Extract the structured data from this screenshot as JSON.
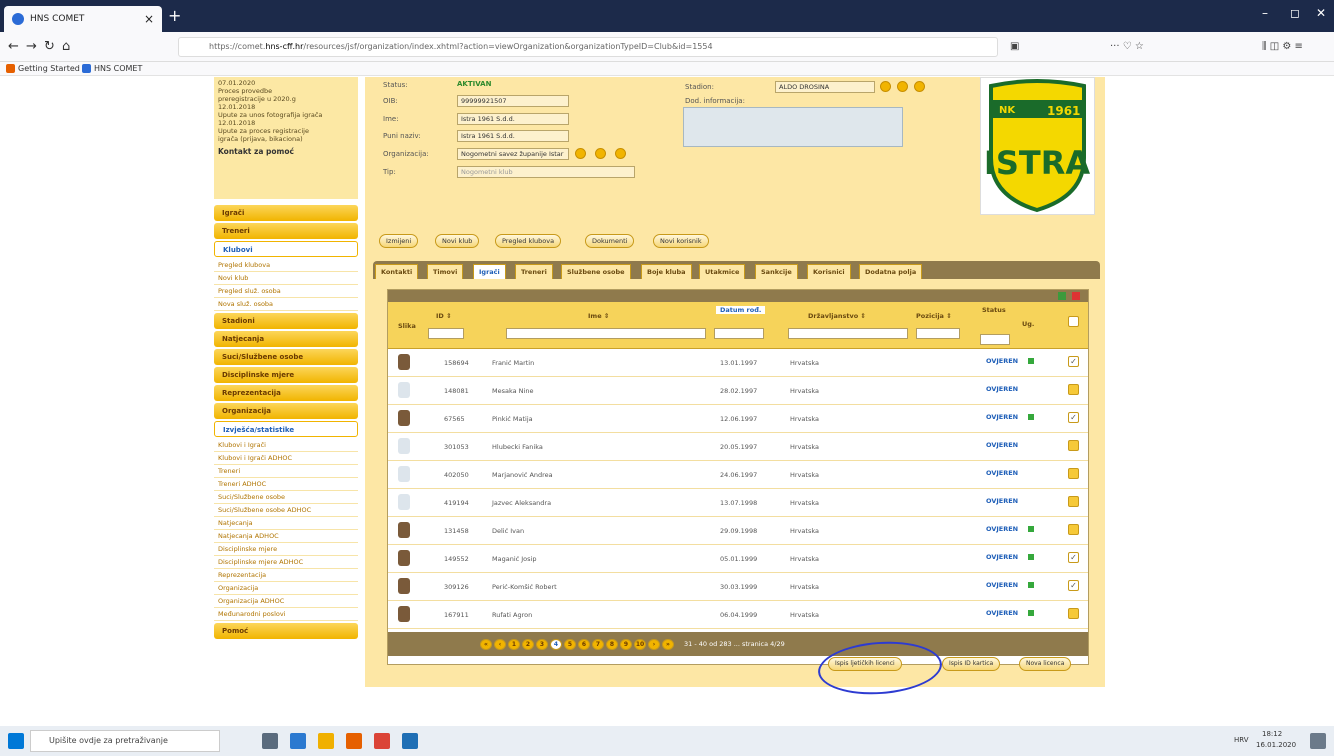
{
  "browser": {
    "tab_title": "HNS COMET",
    "url_pre": "https://comet.",
    "url_host": "hns-cff.hr",
    "url_post": "/resources/jsf/organization/index.xhtml?action=viewOrganization&organizationTypeID=Club&id=1554",
    "bookmarks": [
      "Getting Started",
      "HNS COMET"
    ]
  },
  "news": {
    "lines": [
      "07.01.2020",
      "Proces provedbe",
      "preregistracije u 2020.g",
      "12.01.2018",
      "Upute za unos fotografija igrača",
      "12.01.2018",
      "Upute za proces registracije",
      "igrača (prijava, bikaciona)"
    ],
    "contact": "Kontakt za pomoć"
  },
  "menu": {
    "top": [
      "Igrači",
      "Treneri"
    ],
    "open": "Klubovi",
    "klubovi_sub": [
      "Pregled klubova",
      "Novi klub",
      "Pregled služ. osoba",
      "Nova služ. osoba"
    ],
    "mid": [
      "Stadioni",
      "Natjecanja",
      "Suci/Službene osobe",
      "Disciplinske mjere",
      "Reprezentacija",
      "Organizacija"
    ],
    "open2": "Izvješća/statistike",
    "izvjesca_sub": [
      "Klubovi i Igrači",
      "Klubovi i Igrači ADHOC",
      "Treneri",
      "Treneri ADHOC",
      "Suci/Službene osobe",
      "Suci/Službene osobe ADHOC",
      "Natjecanja",
      "Natjecanja ADHOC",
      "Disciplinske mjere",
      "Disciplinske mjere ADHOC",
      "Reprezentacija",
      "Organizacija",
      "Organizacija ADHOC",
      "Međunarodni poslovi"
    ],
    "last": "Pomoć"
  },
  "form": {
    "status_label": "Status:",
    "status_value": "AKTIVAN",
    "oib_label": "OIB:",
    "oib_value": "99999921507",
    "ime_label": "Ime:",
    "ime_value": "Istra 1961 S.d.d.",
    "puni_label": "Puni naziv:",
    "puni_value": "Istra 1961 S.d.d.",
    "org_label": "Organizacija:",
    "org_value": "Nogometni savez županije Istar",
    "tip_label": "Tip:",
    "tip_value": "Nogometni klub",
    "stadion_label": "Stadion:",
    "stadion_value": "ALDO DROSINA",
    "dod_label": "Dod. informacija:"
  },
  "logo": {
    "line1": "NK",
    "line2": "1961",
    "name": "ISTRA"
  },
  "actions": [
    "Izmijeni",
    "Novi klub",
    "Pregled klubova",
    "Dokumenti",
    "Novi korisnik"
  ],
  "tabs": [
    "Kontakti",
    "Timovi",
    "Igrači",
    "Treneri",
    "Službene osobe",
    "Boje kluba",
    "Utakmice",
    "Sankcije",
    "Korisnici",
    "Dodatna polja"
  ],
  "grid_headers": {
    "slika": "Slika",
    "id": "ID ⇕",
    "ime": "Ime ⇕",
    "datum": "Datum rođ.",
    "drz": "Državljanstvo ⇕",
    "poz": "Pozicija ⇕",
    "status": "Status",
    "ug": "Ug."
  },
  "rows": [
    {
      "id": "158694",
      "name": "Franić Martin",
      "date": "13.01.1997",
      "country": "Hrvatska",
      "status": "OVJEREN",
      "green": true,
      "checked": true,
      "photo": true
    },
    {
      "id": "148081",
      "name": "Mesaka Nine",
      "date": "28.02.1997",
      "country": "Hrvatska",
      "status": "OVJEREN",
      "green": false,
      "checked": false,
      "photo": false
    },
    {
      "id": "67565",
      "name": "Pinkić Matija",
      "date": "12.06.1997",
      "country": "Hrvatska",
      "status": "OVJEREN",
      "green": true,
      "checked": true,
      "photo": true
    },
    {
      "id": "301053",
      "name": "Hlubecki Fanika",
      "date": "20.05.1997",
      "country": "Hrvatska",
      "status": "OVJEREN",
      "green": false,
      "checked": false,
      "photo": false
    },
    {
      "id": "402050",
      "name": "Marjanović Andrea",
      "date": "24.06.1997",
      "country": "Hrvatska",
      "status": "OVJEREN",
      "green": false,
      "checked": false,
      "photo": false
    },
    {
      "id": "419194",
      "name": "Jazvec Aleksandra",
      "date": "13.07.1998",
      "country": "Hrvatska",
      "status": "OVJEREN",
      "green": false,
      "checked": false,
      "photo": false
    },
    {
      "id": "131458",
      "name": "Delić Ivan",
      "date": "29.09.1998",
      "country": "Hrvatska",
      "status": "OVJEREN",
      "green": true,
      "checked": false,
      "photo": true
    },
    {
      "id": "149552",
      "name": "Maganić Josip",
      "date": "05.01.1999",
      "country": "Hrvatska",
      "status": "OVJEREN",
      "green": true,
      "checked": true,
      "photo": true
    },
    {
      "id": "309126",
      "name": "Perić-Komšić Robert",
      "date": "30.03.1999",
      "country": "Hrvatska",
      "status": "OVJEREN",
      "green": true,
      "checked": true,
      "photo": true
    },
    {
      "id": "167911",
      "name": "Rufati Agron",
      "date": "06.04.1999",
      "country": "Hrvatska",
      "status": "OVJEREN",
      "green": true,
      "checked": false,
      "photo": true
    }
  ],
  "pager": {
    "pages": [
      "1",
      "2",
      "3",
      "4",
      "5",
      "6",
      "7",
      "8",
      "9",
      "10"
    ],
    "current": "4",
    "info": "31 - 40 od 283 ... stranica 4/29"
  },
  "bottom": [
    "Ispis ljetičkih licenci",
    "Ispis ID kartica",
    "Nova licenca"
  ],
  "taskbar": {
    "search": "Upišite ovdje za pretraživanje",
    "time": "18:12",
    "date": "16.01.2020",
    "lang": "HRV"
  }
}
